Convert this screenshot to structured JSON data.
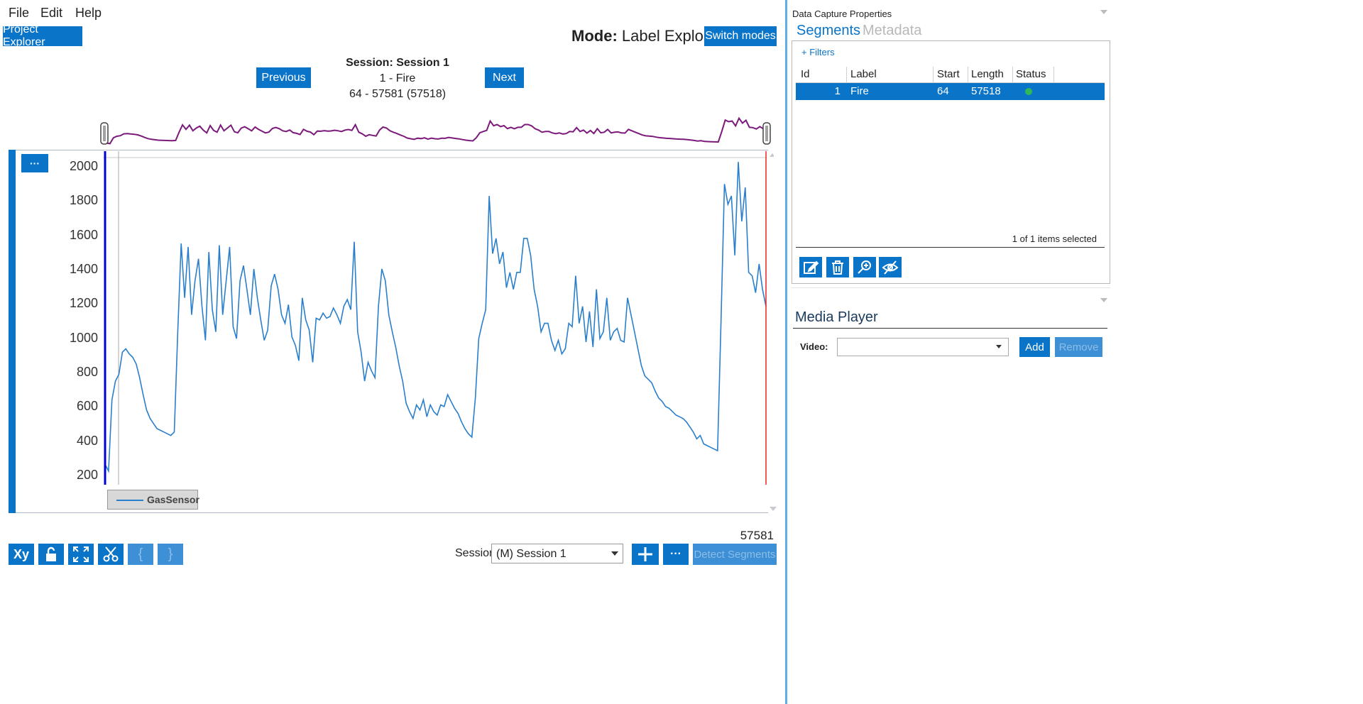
{
  "menu": [
    "File",
    "Edit",
    "Help"
  ],
  "project_explorer_label": "Project Explorer",
  "mode": {
    "prefix": "Mode:",
    "value": "Label Explorer",
    "switch_label": "Switch modes"
  },
  "session_nav": {
    "title": "Session: Session 1",
    "segment": "1 - Fire",
    "range": "64 - 57581 (57518)",
    "previous_label": "Previous",
    "next_label": "Next"
  },
  "chart_menu_label": "···",
  "chart_end_value": "57581",
  "chart_data": {
    "type": "line",
    "title": "",
    "xlabel": "",
    "ylabel": "",
    "x_range": [
      64,
      57581
    ],
    "ylim": [
      150,
      2080
    ],
    "yticks": [
      "2000",
      "1800",
      "1600",
      "1400",
      "1200",
      "1000",
      "800",
      "600",
      "400",
      "200"
    ],
    "legend": "GasSensor",
    "series": [
      {
        "name": "GasSensor",
        "color": "#2a7fcc",
        "values": [
          270,
          230,
          650,
          760,
          800,
          930,
          950,
          920,
          900,
          860,
          780,
          680,
          590,
          540,
          510,
          480,
          470,
          460,
          450,
          440,
          460,
          1050,
          1570,
          1250,
          1550,
          1150,
          1350,
          1480,
          1200,
          1000,
          1520,
          1180,
          1050,
          1560,
          1150,
          1350,
          1550,
          1080,
          1010,
          1350,
          1440,
          1300,
          1150,
          1420,
          1250,
          1120,
          1000,
          1060,
          1320,
          1390,
          1300,
          1150,
          1100,
          1210,
          1020,
          970,
          880,
          1250,
          1120,
          1060,
          870,
          1130,
          1120,
          1160,
          1130,
          1140,
          1190,
          1150,
          1100,
          1200,
          1240,
          1180,
          1580,
          1050,
          930,
          760,
          870,
          820,
          780,
          1200,
          1420,
          1350,
          1150,
          1050,
          960,
          850,
          760,
          630,
          580,
          540,
          620,
          590,
          650,
          550,
          620,
          580,
          560,
          620,
          610,
          680,
          640,
          600,
          570,
          520,
          480,
          450,
          430,
          660,
          1010,
          1100,
          1180,
          1850,
          1510,
          1600,
          1450,
          1520,
          1310,
          1400,
          1300,
          1400,
          1400,
          1600,
          1600,
          1500,
          1300,
          1200,
          1050,
          1100,
          1100,
          1000,
          940,
          1000,
          920,
          950,
          1100,
          1080,
          1380,
          1100,
          1200,
          990,
          1170,
          960,
          1300,
          1010,
          1050,
          1250,
          1000,
          1050,
          1070,
          1000,
          990,
          1250,
          1150,
          1050,
          950,
          850,
          790,
          770,
          750,
          700,
          660,
          640,
          610,
          600,
          580,
          560,
          550,
          540,
          520,
          490,
          460,
          420,
          440,
          390,
          380,
          370,
          360,
          350,
          1100,
          1920,
          1800,
          1850,
          1500,
          2050,
          1700,
          1900,
          1400,
          1380,
          1280,
          1450,
          1300,
          1200
        ]
      }
    ]
  },
  "toolbar": {
    "xy_label": "Xy",
    "brace_open": "{",
    "brace_close": "}",
    "session_label": "Session:",
    "session_value": "(M) Session 1",
    "detect_label": "Detect Segments"
  },
  "right_panel": {
    "title": "Data Capture Properties",
    "tabs": [
      "Segments",
      "Metadata"
    ],
    "filters_label": "+ Filters",
    "table_headers": [
      "Id",
      "Label",
      "Start",
      "Length",
      "Status"
    ],
    "rows": [
      {
        "id": "1",
        "label": "Fire",
        "start": "64",
        "length": "57518",
        "status_color": "#33b55a"
      }
    ],
    "selection_text": "1 of 1 items selected",
    "media_title": "Media Player",
    "video_label": "Video:",
    "add_label": "Add",
    "remove_label": "Remove"
  }
}
